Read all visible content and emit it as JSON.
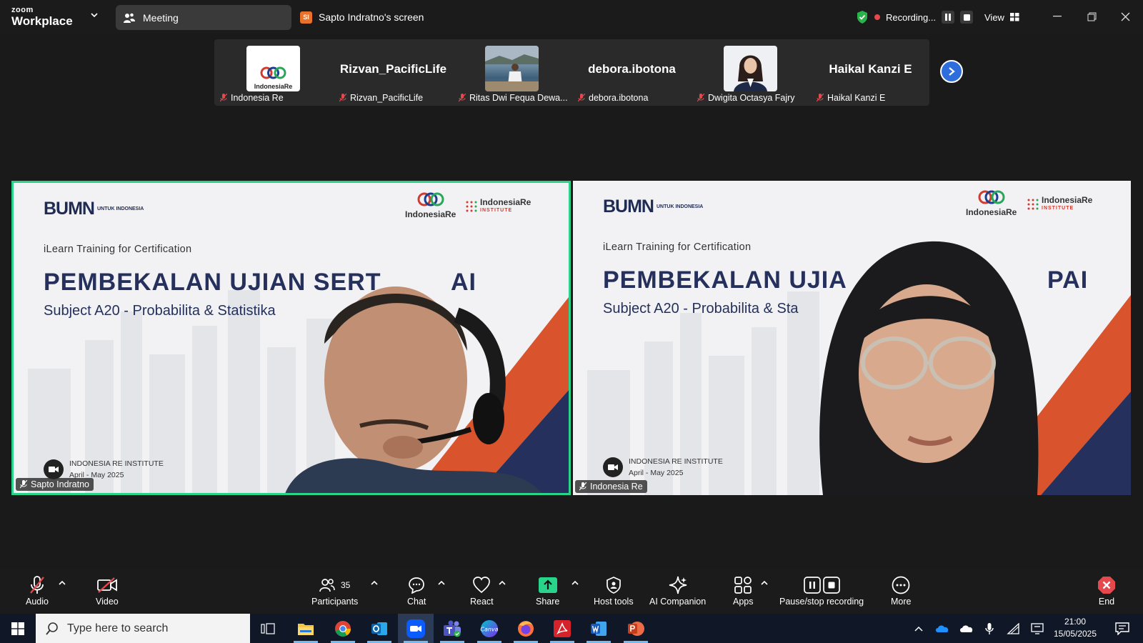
{
  "titlebar": {
    "brand_top": "zoom",
    "brand_bottom": "Workplace",
    "tab_meeting": "Meeting",
    "tab_screen_badge": "SI",
    "tab_screen": "Sapto Indratno's screen",
    "recording": "Recording...",
    "view": "View"
  },
  "strip": {
    "participants": [
      {
        "big": "",
        "small": "Indonesia Re",
        "thumb": "indonesia-re-logo"
      },
      {
        "big": "Rizvan_PacificLife",
        "small": "Rizvan_PacificLife",
        "thumb": ""
      },
      {
        "big": "",
        "small": "Ritas Dwi Fequa Dewa...",
        "thumb": "photo-boat"
      },
      {
        "big": "debora.ibotona",
        "small": "debora.ibotona",
        "thumb": ""
      },
      {
        "big": "",
        "small": "Dwigita Octasya Fajry",
        "thumb": "photo-portrait"
      },
      {
        "big": "Haikal Kanzi E",
        "small": "Haikal Kanzi E",
        "thumb": ""
      }
    ],
    "thumb_logo_text": "IndonesiaRe"
  },
  "slide": {
    "bumn": "BUMN",
    "bumn_small": "UNTUK INDONESIA",
    "logo1": "IndonesiaRe",
    "logo2": "IndonesiaRe",
    "logo2_sub": "INSTITUTE",
    "ilearn": "iLearn Training for Certification",
    "title_left": "PEMBEKALAN UJIAN SERT",
    "title_left_tail": "AI",
    "title_right": "PEMBEKALAN UJIA",
    "title_right_tail": "PAI",
    "subtitle_left": "Subject A20 - Probabilita & Statistika",
    "subtitle_right": "Subject A20 - Probabilita & Sta",
    "footer_org": "INDONESIA RE INSTITUTE",
    "footer_date": "April - May 2025"
  },
  "tiles": [
    {
      "label": "Sapto Indratno",
      "active": true
    },
    {
      "label": "Indonesia Re",
      "active": false
    }
  ],
  "toolbar": {
    "audio": "Audio",
    "video": "Video",
    "participants": "Participants",
    "participants_count": "35",
    "chat": "Chat",
    "react": "React",
    "share": "Share",
    "host_tools": "Host tools",
    "ai_companion": "AI Companion",
    "apps": "Apps",
    "pause_stop": "Pause/stop recording",
    "more": "More",
    "end": "End"
  },
  "taskbar": {
    "search_placeholder": "Type here to search",
    "time": "21:00",
    "date": "15/05/2025"
  },
  "colors": {
    "active_border": "#2ad38a",
    "record_red": "#e5484d",
    "next_blue": "#2e6ddc",
    "share_green": "#2ad38a",
    "end_red": "#e5484d",
    "slide_navy": "#25305c",
    "slide_orange": "#d9532c"
  }
}
